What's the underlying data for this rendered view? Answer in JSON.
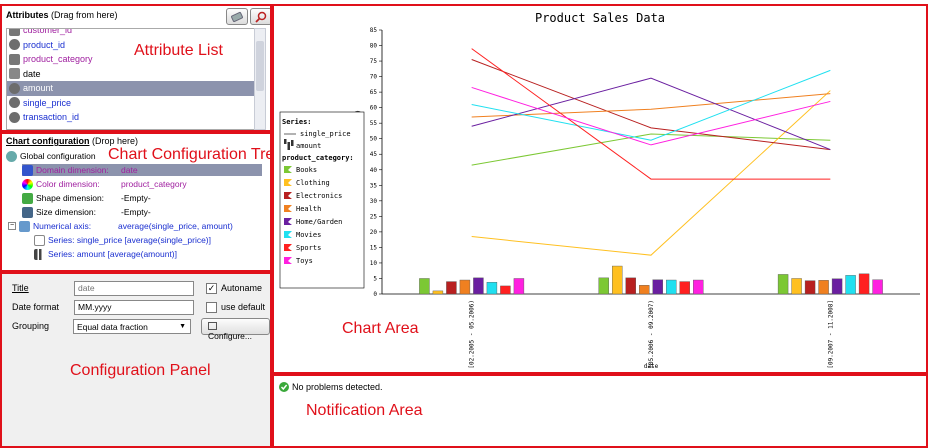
{
  "attributes": {
    "header_bold": "Attributes",
    "header_note": "(Drag from here)",
    "annotation": "Attribute List",
    "items": [
      {
        "label": "customer_id",
        "color": "#a020a0",
        "icon": "nominal-icon"
      },
      {
        "label": "product_id",
        "color": "#1a2fd0",
        "icon": "integer-icon"
      },
      {
        "label": "product_category",
        "color": "#a020a0",
        "icon": "nominal-icon"
      },
      {
        "label": "date",
        "color": "#000000",
        "icon": "date-icon"
      },
      {
        "label": "amount",
        "color": "#1a2fd0",
        "icon": "integer-icon",
        "selected": true
      },
      {
        "label": "single_price",
        "color": "#1a2fd0",
        "icon": "integer-icon"
      },
      {
        "label": "transaction_id",
        "color": "#1a2fd0",
        "icon": "integer-icon"
      }
    ]
  },
  "tree": {
    "header_bold": "Chart configuration",
    "header_note": "(Drop here)",
    "annotation": "Chart Configuration Tree",
    "global": "Global configuration",
    "domain_label": "Domain dimension:",
    "domain_value": "date",
    "color_label": "Color dimension:",
    "color_value": "product_category",
    "shape_label": "Shape dimension:",
    "shape_value": "-Empty-",
    "size_label": "Size dimension:",
    "size_value": "-Empty-",
    "axis_label": "Numerical axis:",
    "axis_value": "average(single_price, amount)",
    "series1": "Series: single_price [average(single_price)]",
    "series2": "Series: amount [average(amount)]"
  },
  "config": {
    "annotation": "Configuration Panel",
    "title_label": "Title",
    "title_placeholder": "date",
    "autoname_label": "Autoname",
    "dateformat_label": "Date format",
    "dateformat_value": "MM.yyyy",
    "usedefault_label": "use default",
    "grouping_label": "Grouping",
    "grouping_value": "Equal data fraction",
    "configure_label": "Configure..."
  },
  "chart_annotation": "Chart Area",
  "notification": {
    "message": "No problems detected.",
    "annotation": "Notification Area"
  },
  "chart_data": {
    "type": "bar",
    "title": "Product Sales Data",
    "xlabel": "date",
    "ylabel": "average(single_price, amount)",
    "ylim": [
      0,
      85
    ],
    "yticks": [
      0,
      5,
      10,
      15,
      20,
      25,
      30,
      35,
      40,
      45,
      50,
      55,
      60,
      65,
      70,
      75,
      80,
      85
    ],
    "categories": [
      "[02.2005 - 05.2006)",
      "[05.2006 - 09.2007)",
      "[09.2007 - 11.2008]"
    ],
    "legend": {
      "series_header": "Series:",
      "line_series": "single_price",
      "bar_series": "amount",
      "category_header": "product_category:"
    },
    "series": [
      {
        "name": "Books",
        "color": "#7cc834",
        "line": [
          41.5,
          51.5,
          49.5
        ],
        "bar": [
          5,
          5.2,
          6.3
        ]
      },
      {
        "name": "Clothing",
        "color": "#ffc020",
        "line": [
          18.5,
          12.5,
          65.5
        ],
        "bar": [
          1,
          9,
          5
        ]
      },
      {
        "name": "Electronics",
        "color": "#b82020",
        "line": [
          75.5,
          53.5,
          46.5
        ],
        "bar": [
          4,
          5.2,
          4.3
        ]
      },
      {
        "name": "Health",
        "color": "#f08020",
        "line": [
          57,
          59.5,
          64.5
        ],
        "bar": [
          4.5,
          2.8,
          4.4
        ]
      },
      {
        "name": "Home/Garden",
        "color": "#6a1fa0",
        "line": [
          54,
          69.5,
          46.5
        ],
        "bar": [
          5.2,
          4.6,
          4.9
        ]
      },
      {
        "name": "Movies",
        "color": "#20e0f0",
        "line": [
          61,
          49.5,
          72
        ],
        "bar": [
          3.8,
          4.5,
          6
        ]
      },
      {
        "name": "Sports",
        "color": "#ff2020",
        "line": [
          79,
          37,
          37
        ],
        "bar": [
          2.6,
          4,
          6.5
        ]
      },
      {
        "name": "Toys",
        "color": "#ff20e0",
        "line": [
          66.5,
          48,
          62
        ],
        "bar": [
          5,
          4.5,
          4.6
        ]
      }
    ]
  }
}
